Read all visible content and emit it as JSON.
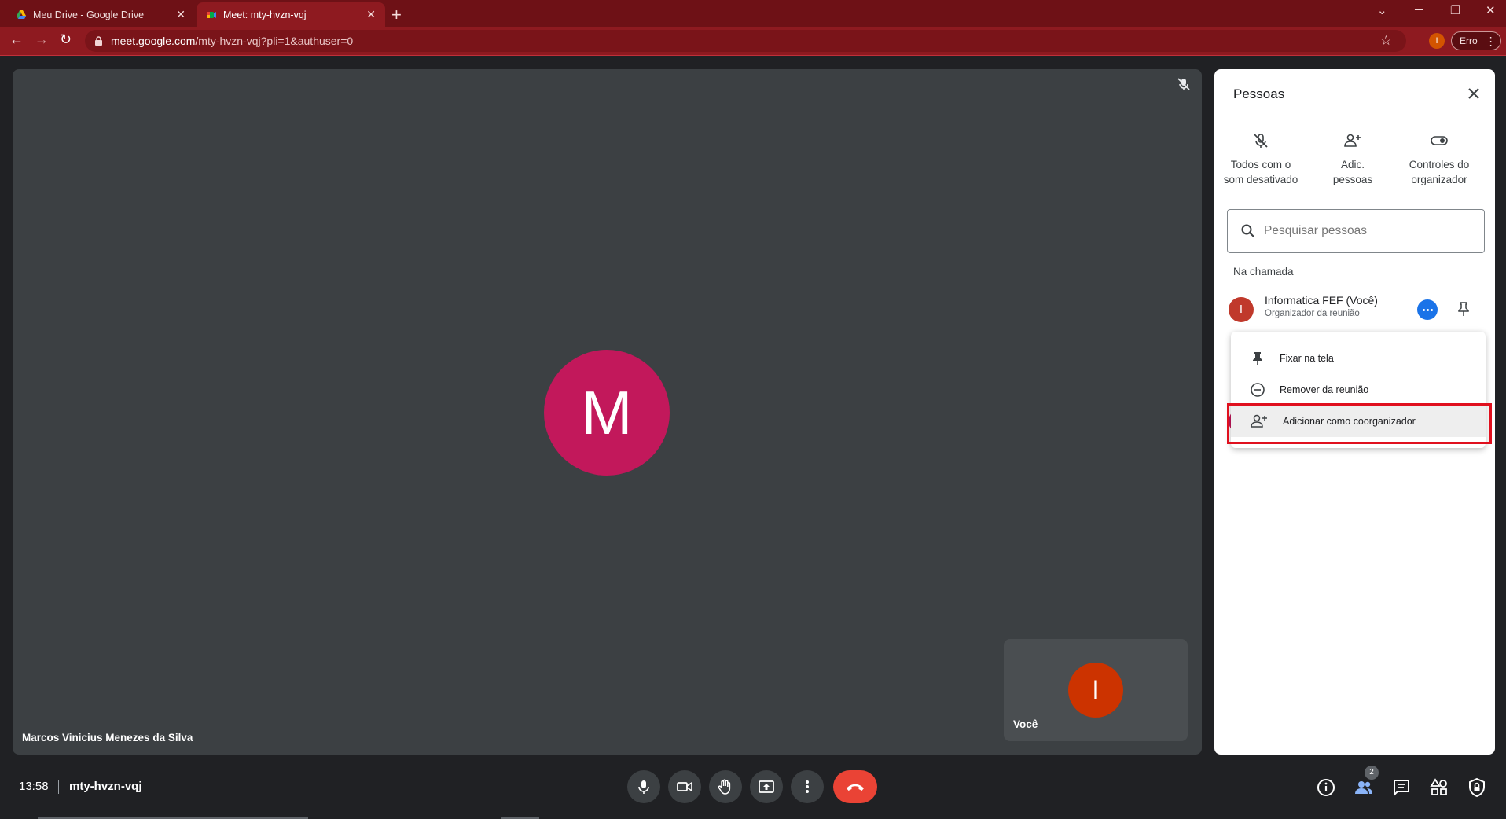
{
  "browser": {
    "tabs": [
      {
        "title": "Meu Drive - Google Drive",
        "active": false
      },
      {
        "title": "Meet: mty-hvzn-vqj",
        "active": true
      }
    ],
    "url_host": "meet.google.com",
    "url_path": "/mty-hvzn-vqj?pli=1&authuser=0",
    "profile_initial": "I",
    "error_label": "Erro"
  },
  "stage": {
    "main_initial": "M",
    "main_name": "Marcos Vinicius Menezes da Silva",
    "self_initial": "I",
    "self_label": "Você",
    "main_avatar_color": "#c2185b",
    "self_avatar_color": "#cc3300"
  },
  "panel": {
    "title": "Pessoas",
    "actions": [
      {
        "label_line1": "Todos com o",
        "label_line2": "som desativado",
        "icon": "mic-off-icon"
      },
      {
        "label_line1": "Adic.",
        "label_line2": "pessoas",
        "icon": "person-add-icon"
      },
      {
        "label_line1": "Controles do",
        "label_line2": "organizador",
        "icon": "toggle-icon"
      }
    ],
    "search_placeholder": "Pesquisar pessoas",
    "section_label": "Na chamada",
    "participants": [
      {
        "initial": "I",
        "name": "Informatica FEF (Você)",
        "role": "Organizador da reunião"
      }
    ]
  },
  "menu": {
    "items": [
      {
        "label": "Fixar na tela",
        "icon": "pin-icon"
      },
      {
        "label": "Remover da reunião",
        "icon": "remove-circle-icon"
      },
      {
        "label": "Adicionar como coorganizador",
        "icon": "person-add-icon"
      }
    ]
  },
  "bottom": {
    "time": "13:58",
    "meeting_code": "mty-hvzn-vqj",
    "people_count": "2"
  },
  "colors": {
    "accent_blue": "#1a73e8",
    "end_call_red": "#ea4335",
    "browser_frame": "#6e1116",
    "highlight_red": "#e0101e"
  }
}
